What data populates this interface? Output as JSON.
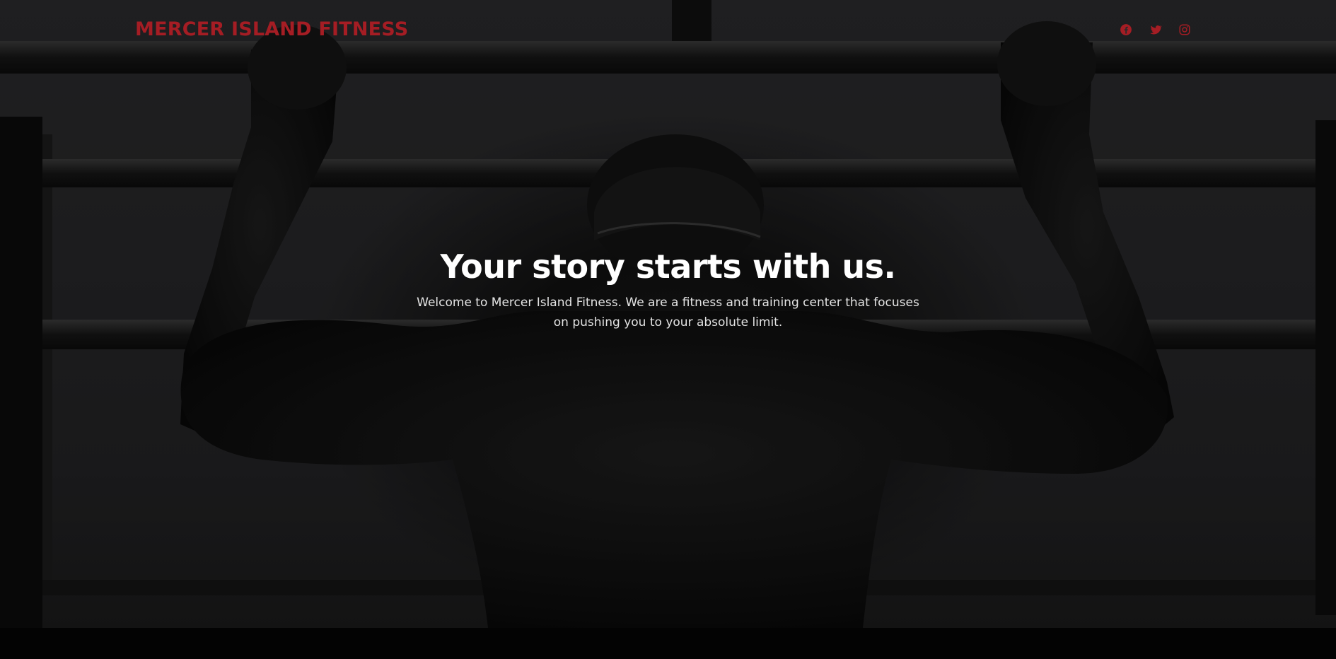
{
  "navbar": {
    "brand": "MERCER ISLAND FITNESS",
    "social": [
      {
        "icon": "facebook-icon"
      },
      {
        "icon": "twitter-icon"
      },
      {
        "icon": "instagram-icon"
      }
    ]
  },
  "hero": {
    "title": "Your story starts with us.",
    "text": "Welcome to Mercer Island Fitness. We are a fitness and training center that focuses on pushing you to your absolute limit."
  },
  "colors": {
    "brand": "#a51d24",
    "background": "#000000",
    "hero_text": "#ffffff"
  }
}
